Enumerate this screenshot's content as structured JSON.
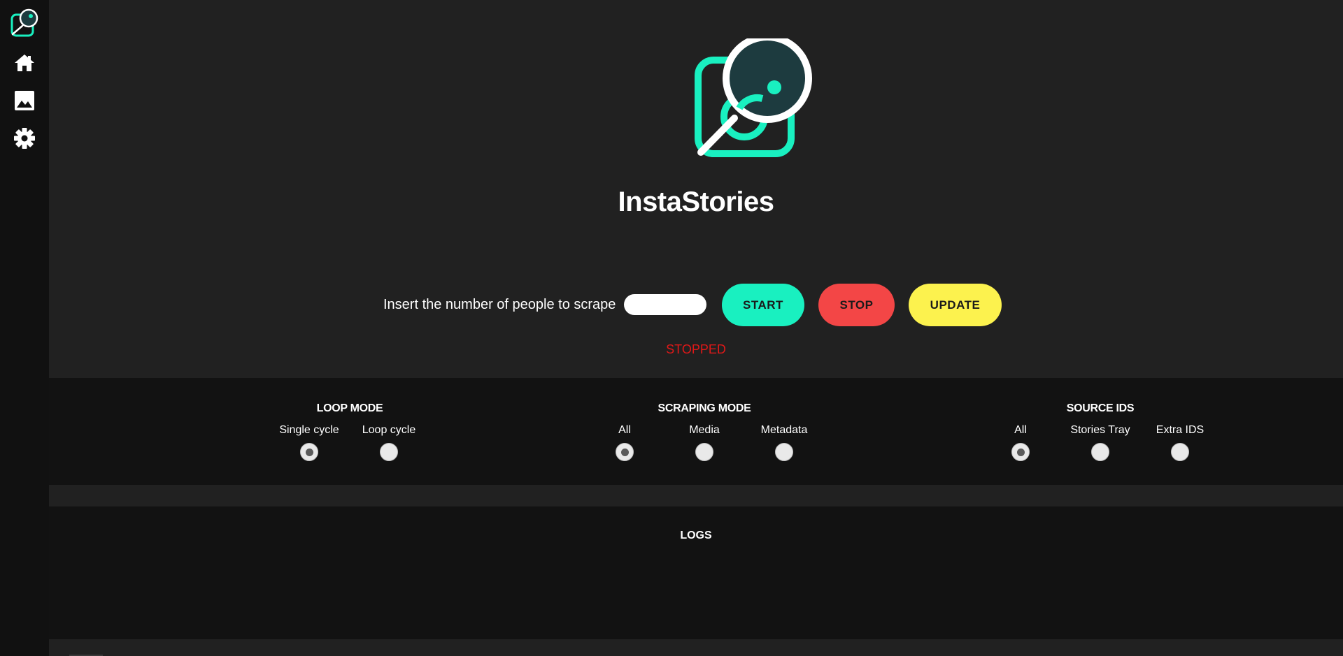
{
  "app": {
    "title": "InstaStories"
  },
  "sidebar": {
    "items": [
      {
        "name": "logo",
        "icon": "instastories-logo-icon"
      },
      {
        "name": "home",
        "icon": "home-icon"
      },
      {
        "name": "gallery",
        "icon": "image-icon"
      },
      {
        "name": "settings",
        "icon": "gear-icon"
      }
    ]
  },
  "controls": {
    "prompt": "Insert the number of people to scrape",
    "input_value": "",
    "start_label": "START",
    "stop_label": "STOP",
    "update_label": "UPDATE",
    "status": "STOPPED"
  },
  "modes": {
    "loop": {
      "title": "LOOP MODE",
      "options": [
        "Single cycle",
        "Loop cycle"
      ],
      "selected": "Single cycle"
    },
    "scraping": {
      "title": "SCRAPING MODE",
      "options": [
        "All",
        "Media",
        "Metadata"
      ],
      "selected": "All"
    },
    "source": {
      "title": "SOURCE IDS",
      "options": [
        "All",
        "Stories Tray",
        "Extra IDS"
      ],
      "selected": "All"
    }
  },
  "logs": {
    "title": "LOGS"
  },
  "colors": {
    "accent": "#19f0c0",
    "stop": "#f34646",
    "update": "#fcf24e",
    "status_stopped": "#e01818",
    "background": "#212121",
    "panel": "#121212",
    "sidebar": "#111111"
  }
}
